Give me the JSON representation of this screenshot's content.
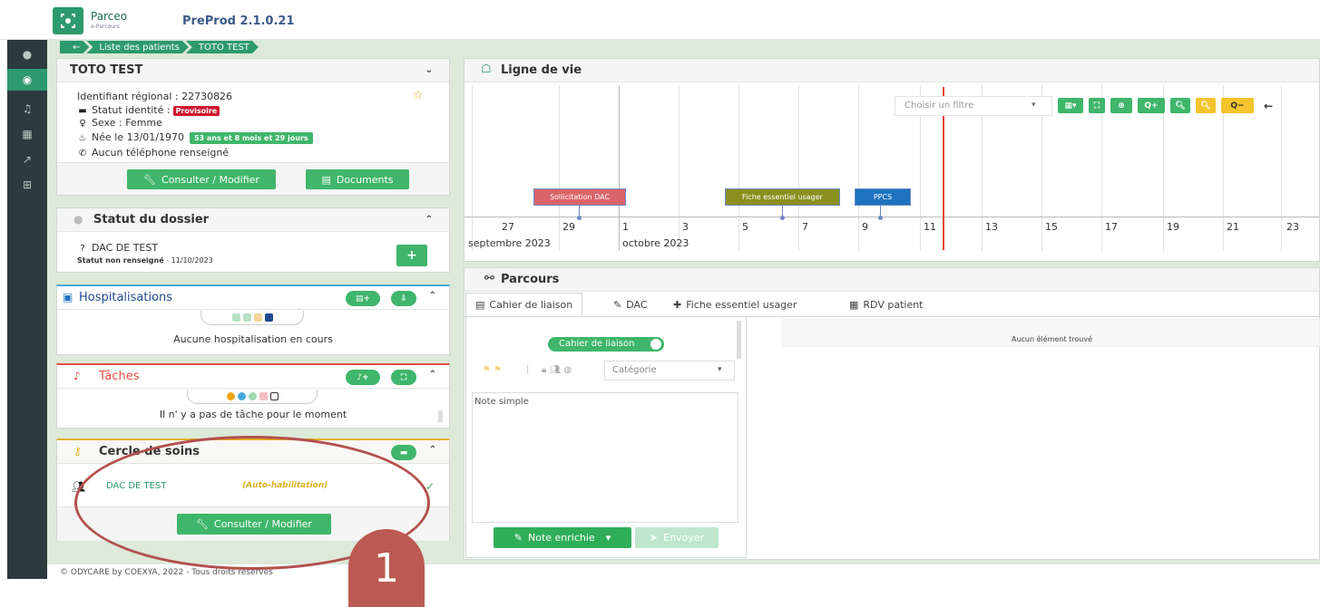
{
  "header": {
    "brand": "Parceo",
    "brand_sub": "e-Parcours",
    "version": "PreProd 2.1.0.21"
  },
  "sidebar": {
    "icons": [
      "user-circle-icon",
      "patient-target-icon",
      "bell-icon",
      "calendar-icon",
      "chart-icon",
      "grid-icon"
    ]
  },
  "breadcrumb": {
    "back": "←",
    "items": [
      "Liste des patients",
      "TOTO TEST"
    ]
  },
  "patient": {
    "title": "TOTO TEST",
    "regional_id": "Identifiant régional : 22730826",
    "identity_status_label": "Statut identité :",
    "identity_status_badge": "Provisoire",
    "sex": "Sexe : Femme",
    "birth": "Née le 13/01/1970",
    "age_badge": "53 ans et 8 mois et 29 jours",
    "phone": "Aucun téléphone renseigné",
    "consult_button": "Consulter / Modifier",
    "documents_button": "Documents"
  },
  "dossier": {
    "title": "Statut du dossier",
    "dac": "DAC DE TEST",
    "status_bold": "Statut non renseigné",
    "status_date": " - 11/10/2023",
    "add_button": "+"
  },
  "hospitalisations": {
    "title": "Hospitalisations",
    "empty": "Aucune hospitalisation en cours"
  },
  "taches": {
    "title": "Tâches",
    "empty": "Il n' y a pas de tâche pour le moment"
  },
  "cercle": {
    "title": "Cercle de soins",
    "member": "DAC DE TEST",
    "member_note": "(Auto-habilitation)",
    "consult_button": "Consulter / Modifier"
  },
  "timeline": {
    "title": "Ligne de vie",
    "filter_placeholder": "Choisir un filtre",
    "ticks": [
      "27",
      "29",
      "1",
      "3",
      "5",
      "7",
      "9",
      "11",
      "13",
      "15",
      "17",
      "19",
      "21",
      "23"
    ],
    "month_labels": [
      "septembre 2023",
      "octobre 2023"
    ],
    "events": [
      "Sollicitation DAC",
      "Fiche essentiel usager",
      "PPCS"
    ],
    "colors": {
      "sollicitation": "#d9646a",
      "fiche": "#8a8f1e",
      "ppcs": "#1e72bf",
      "today": "#e8413a"
    },
    "zoom_in": "Q+",
    "zoom_out": "Q−",
    "arrow": "←"
  },
  "parcours": {
    "title": "Parcours",
    "tabs": [
      "Cahier de liaison",
      "DAC",
      "Fiche essentiel usager",
      "RDV patient"
    ],
    "toggle_label": "Cahier de liaison",
    "category_placeholder": "Catégorie",
    "note_placeholder": "Note simple",
    "rich_note_button": "Note enrichie",
    "send_button": "Envoyer",
    "empty": "Aucun élément trouvé"
  },
  "annotation": {
    "number": "1"
  },
  "footer": {
    "text": "© ODYCARE by COEXYA, 2022 - Tous droits réservés"
  }
}
